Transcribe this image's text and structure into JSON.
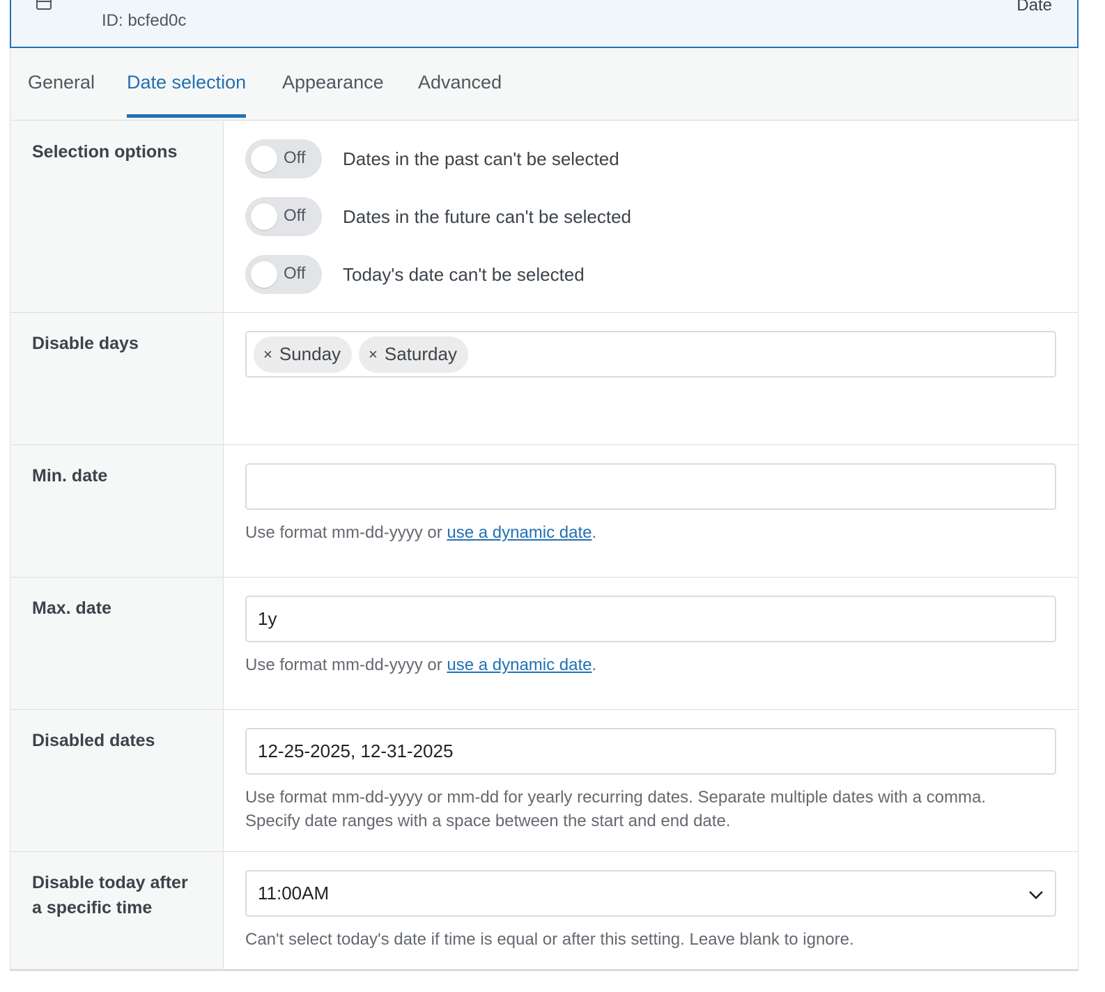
{
  "header": {
    "field_id": "ID: bcfed0c",
    "field_type": "Date"
  },
  "tabs": [
    {
      "label": "General",
      "active": false
    },
    {
      "label": "Date selection",
      "active": true
    },
    {
      "label": "Appearance",
      "active": false
    },
    {
      "label": "Advanced",
      "active": false
    }
  ],
  "selection_options": {
    "label": "Selection options",
    "toggles": [
      {
        "state": "Off",
        "description": "Dates in the past can't be selected"
      },
      {
        "state": "Off",
        "description": "Dates in the future can't be selected"
      },
      {
        "state": "Off",
        "description": "Today's date can't be selected"
      }
    ]
  },
  "disable_days": {
    "label": "Disable days",
    "chips": [
      "Sunday",
      "Saturday"
    ]
  },
  "min_date": {
    "label": "Min. date",
    "value": "",
    "help_prefix": "Use format mm-dd-yyyy or ",
    "help_link": "use a dynamic date",
    "help_suffix": "."
  },
  "max_date": {
    "label": "Max. date",
    "value": "1y",
    "help_prefix": "Use format mm-dd-yyyy or ",
    "help_link": "use a dynamic date",
    "help_suffix": "."
  },
  "disabled_dates": {
    "label": "Disabled dates",
    "value": "12-25-2025, 12-31-2025",
    "help_line1": "Use format mm-dd-yyyy or mm-dd for yearly recurring dates. Separate multiple dates with a comma.",
    "help_line2": "Specify date ranges with a space between the start and end date."
  },
  "disable_today_after": {
    "label_line1": "Disable today after",
    "label_line2": "a specific time",
    "value": "11:00AM",
    "help": "Can't select today's date if time is equal or after this setting. Leave blank to ignore."
  },
  "icons": {
    "calendar": "calendar-icon",
    "chip_remove": "×",
    "dropdown": "chevron-down-icon"
  },
  "colors": {
    "accent": "#2271b1",
    "header_bg": "#f0f6fc",
    "label_bg": "#f6f7f7",
    "toggle_bg": "#e2e4e7"
  }
}
